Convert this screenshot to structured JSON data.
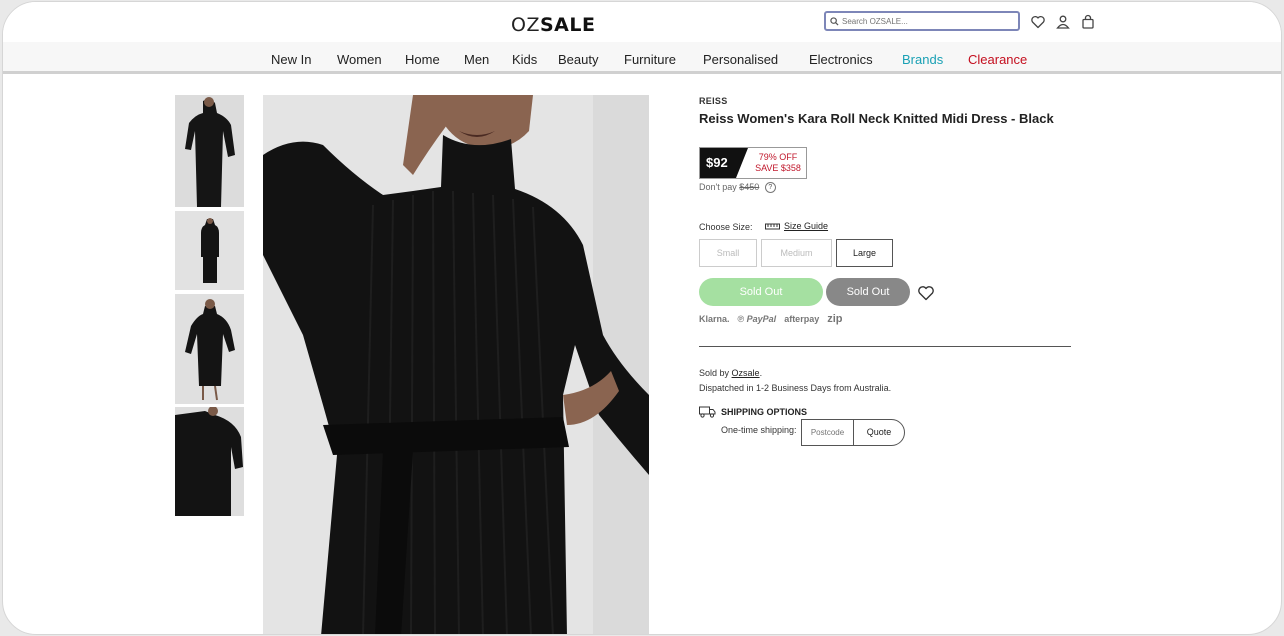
{
  "header": {
    "logo_left": "OZ",
    "logo_right": "SALE",
    "search_placeholder": "Search OZSALE..."
  },
  "nav": [
    {
      "label": "New In",
      "color": "#222222"
    },
    {
      "label": "Women",
      "color": "#222222"
    },
    {
      "label": "Home",
      "color": "#222222"
    },
    {
      "label": "Men",
      "color": "#222222"
    },
    {
      "label": "Kids",
      "color": "#222222"
    },
    {
      "label": "Beauty",
      "color": "#222222"
    },
    {
      "label": "Furniture",
      "color": "#222222"
    },
    {
      "label": "Personalised",
      "color": "#222222"
    },
    {
      "label": "Electronics",
      "color": "#222222"
    },
    {
      "label": "Brands",
      "color": "#1aa1b5"
    },
    {
      "label": "Clearance",
      "color": "#c40f1f"
    }
  ],
  "product": {
    "brand": "REISS",
    "title": "Reiss Women's Kara Roll Neck Knitted Midi Dress - Black",
    "price": "$92",
    "discount": "79% OFF",
    "save": "SAVE $358",
    "dont_pay_label": "Don't pay",
    "original_price": "$450",
    "choose_size_label": "Choose Size:",
    "size_guide_label": "Size Guide",
    "sizes": [
      {
        "label": "Small",
        "available": false
      },
      {
        "label": "Medium",
        "available": false
      },
      {
        "label": "Large",
        "available": true
      }
    ],
    "sold_out_primary": "Sold Out",
    "sold_out_secondary": "Sold Out",
    "payment_methods": [
      "Klarna.",
      "PayPal",
      "afterpay",
      "zip"
    ],
    "sold_by_label": "Sold by",
    "seller": "Ozsale",
    "dispatch": "Dispatched in 1-2 Business Days from Australia.",
    "shipping_title": "SHIPPING OPTIONS",
    "one_time_shipping": "One-time shipping:",
    "postcode_placeholder": "Postcode",
    "quote_label": "Quote"
  },
  "colors": {
    "accent_green": "#a5e0a1",
    "sold_out_gray": "#888888",
    "discount_red": "#c0172b"
  }
}
